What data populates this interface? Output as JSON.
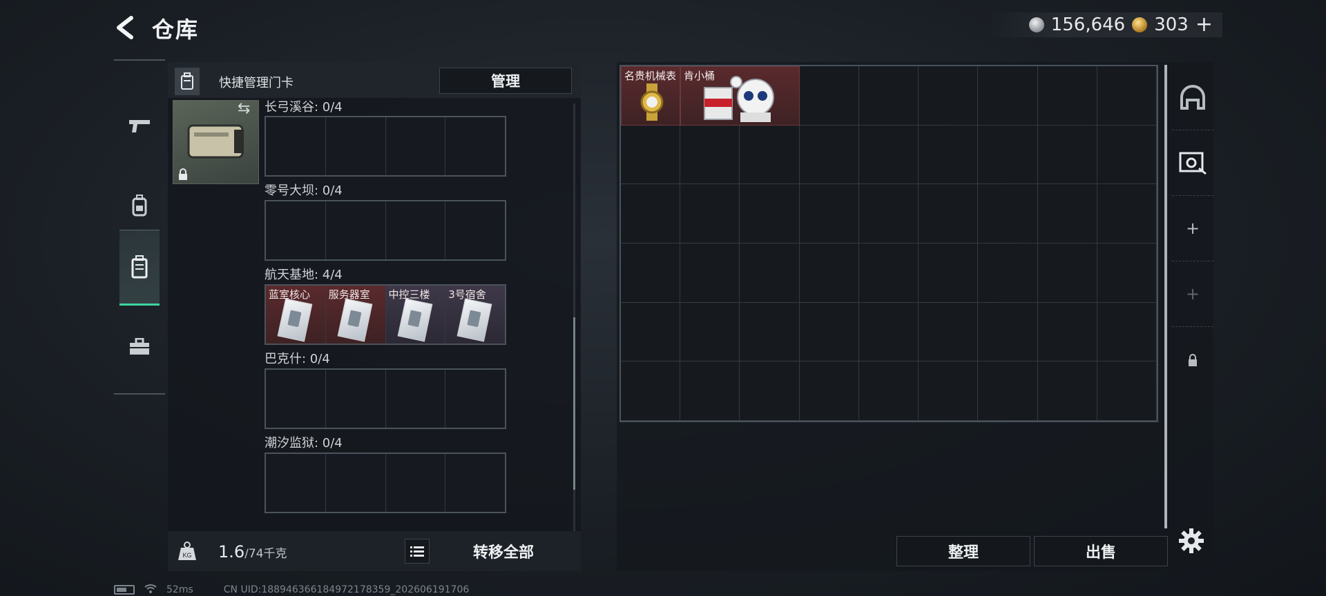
{
  "header": {
    "title": "仓库",
    "currencies": [
      {
        "name": "silver-coin",
        "value": "156,646"
      },
      {
        "name": "gold-coin",
        "value": "303"
      }
    ],
    "add_label": "+"
  },
  "left_rail": {
    "items": [
      {
        "icon": "gun-icon",
        "active": false
      },
      {
        "icon": "backpack-icon",
        "active": false
      },
      {
        "icon": "keycard-case-icon",
        "active": true
      },
      {
        "icon": "toolbox-icon",
        "active": false
      }
    ]
  },
  "keycard_panel": {
    "title": "快捷管理门卡",
    "manage_label": "管理",
    "zones": [
      {
        "label": "长弓溪谷: 0/4",
        "cells": [
          null,
          null,
          null,
          null
        ]
      },
      {
        "label": "零号大坝: 0/4",
        "cells": [
          null,
          null,
          null,
          null
        ]
      },
      {
        "label": "航天基地: 4/4",
        "cells": [
          {
            "name": "蓝室核心",
            "rarity": "red"
          },
          {
            "name": "服务器室",
            "rarity": "red"
          },
          {
            "name": "中控三楼",
            "rarity": "purple"
          },
          {
            "name": "3号宿舍",
            "rarity": "purple"
          }
        ]
      },
      {
        "label": "巴克什: 0/4",
        "cells": [
          null,
          null,
          null,
          null
        ]
      },
      {
        "label": "潮汐监狱: 0/4",
        "cells": [
          null,
          null,
          null,
          null
        ]
      }
    ],
    "weight_current": "1.6",
    "weight_max": "/74千克",
    "transfer_all_label": "转移全部"
  },
  "stash": {
    "items": [
      {
        "name": "名贵机械表",
        "rarity": "red"
      },
      {
        "name": "肯小桶",
        "rarity": "red"
      }
    ],
    "sort_label": "整理",
    "sell_label": "出售"
  },
  "right_tabs": [
    {
      "icon": "helmet-icon"
    },
    {
      "icon": "stash-tools-icon"
    },
    {
      "icon": "plus-icon",
      "label": "+"
    },
    {
      "icon": "plus-icon-dim",
      "label": "+"
    },
    {
      "icon": "lock-icon"
    }
  ],
  "status_bar": {
    "ping": "52ms",
    "uid": "CN UID:18894636618497217835​9_202606191706"
  },
  "colors": {
    "accent_green": "#3fd6a0",
    "rarity_red": "#5a2a2d",
    "rarity_purple": "#3e3848"
  }
}
